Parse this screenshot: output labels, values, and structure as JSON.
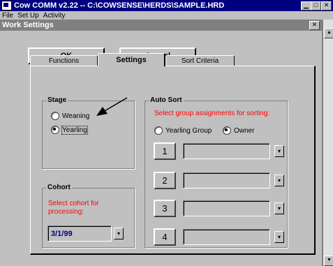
{
  "app": {
    "title": "Cow COMM v2.22 -- C:\\COWSENSE\\HERDS\\SAMPLE.HRD",
    "minimize_glyph": "▁",
    "maximize_glyph": "□",
    "close_glyph": "✕"
  },
  "menu": {
    "items": [
      "File",
      "Set Up",
      "Activity"
    ]
  },
  "child_window": {
    "title": "Work Settings",
    "close_glyph": "✕"
  },
  "buttons": {
    "ok_label": "OK",
    "cancel_label": "Cancel"
  },
  "tabs": [
    {
      "label": "Functions",
      "active": false
    },
    {
      "label": "Settings",
      "active": true
    },
    {
      "label": "Sort Criteria",
      "active": false
    }
  ],
  "stage": {
    "title": "Stage",
    "options": [
      {
        "label": "Weaning",
        "checked": false
      },
      {
        "label": "Yearling",
        "checked": true
      }
    ]
  },
  "cohort": {
    "title": "Cohort",
    "prompt": "Select cohort for processing:",
    "value": "3/1/99"
  },
  "auto_sort": {
    "title": "Auto Sort",
    "prompt": "Select group assignments for sorting:",
    "options": [
      {
        "label": "Yearling Group",
        "checked": false
      },
      {
        "label": "Owner",
        "checked": true
      }
    ],
    "slots": [
      "1",
      "2",
      "3",
      "4"
    ]
  },
  "glyphs": {
    "dropdown": "▾",
    "scroll_up": "▲",
    "scroll_down": "▼"
  }
}
